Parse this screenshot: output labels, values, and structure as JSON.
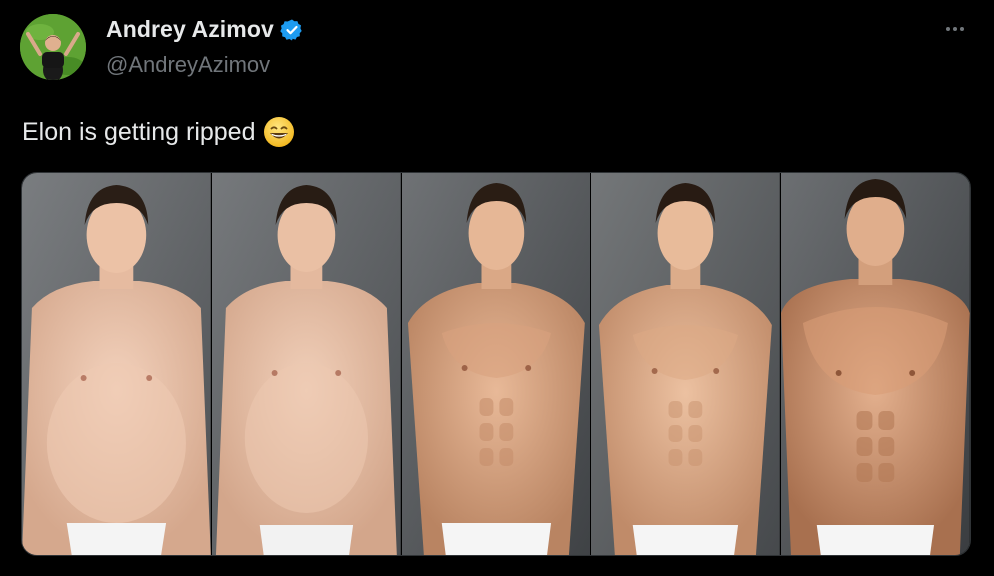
{
  "author": {
    "display_name": "Andrey Azimov",
    "handle": "@AndreyAzimov",
    "verified": true,
    "avatar_icon": "avatar-person-on-grass"
  },
  "tweet": {
    "text": "Elon is getting ripped",
    "emoji_icon": "grinning-face-emoji"
  },
  "media": {
    "panels": [
      {
        "label": "stage-1",
        "build": "soft"
      },
      {
        "label": "stage-2",
        "build": "soft"
      },
      {
        "label": "stage-3",
        "build": "lean"
      },
      {
        "label": "stage-4",
        "build": "lean"
      },
      {
        "label": "stage-5",
        "build": "muscular"
      }
    ]
  },
  "colors": {
    "background": "#000000",
    "text": "#e7e9ea",
    "secondary_text": "#71767b",
    "verified_blue": "#1d9bf0"
  },
  "icons": {
    "more": "more-horizontal-icon",
    "verified": "verified-badge-icon"
  }
}
